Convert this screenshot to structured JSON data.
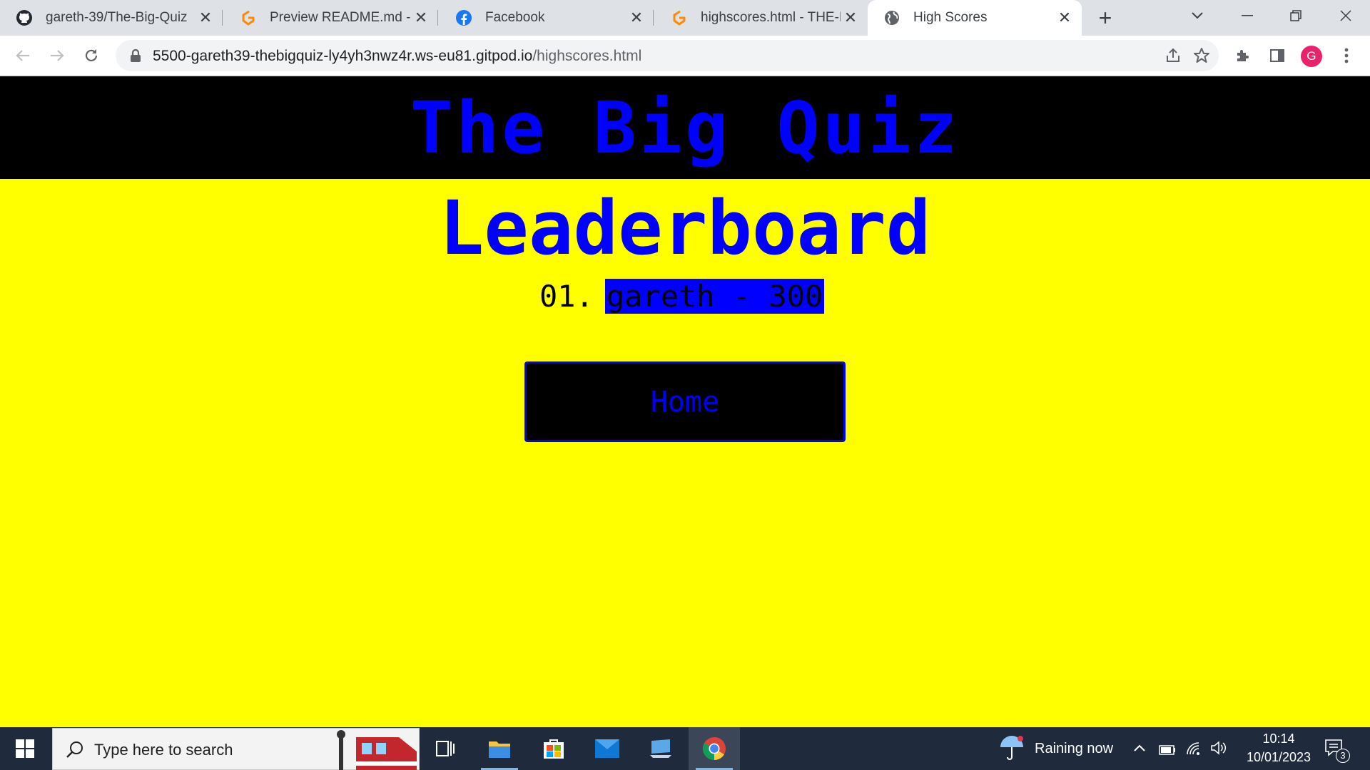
{
  "browser": {
    "tabs": [
      {
        "title": "gareth-39/The-Big-Quiz",
        "icon": "github-icon",
        "active": false
      },
      {
        "title": "Preview README.md - Th",
        "icon": "gitpod-icon",
        "active": false
      },
      {
        "title": "Facebook",
        "icon": "facebook-icon",
        "active": false
      },
      {
        "title": "highscores.html - THE-BIG",
        "icon": "gitpod-icon",
        "active": false
      },
      {
        "title": "High Scores",
        "icon": "globe-icon",
        "active": true
      }
    ],
    "url_host": "5500-gareth39-thebigquiz-ly4yh3nwz4r.ws-eu81.gitpod.io",
    "url_path": "/highscores.html",
    "profile_initial": "G"
  },
  "page": {
    "site_title": "The Big Quiz",
    "heading": "Leaderboard",
    "scores": [
      {
        "rank": "01.",
        "entry": "gareth - 300"
      }
    ],
    "home_button": "Home",
    "colors": {
      "background": "#ffff00",
      "header": "#000000",
      "accent": "#0000ff"
    }
  },
  "taskbar": {
    "search_placeholder": "Type here to search",
    "weather": "Raining now",
    "time": "10:14",
    "date": "10/01/2023",
    "notification_count": "3"
  }
}
